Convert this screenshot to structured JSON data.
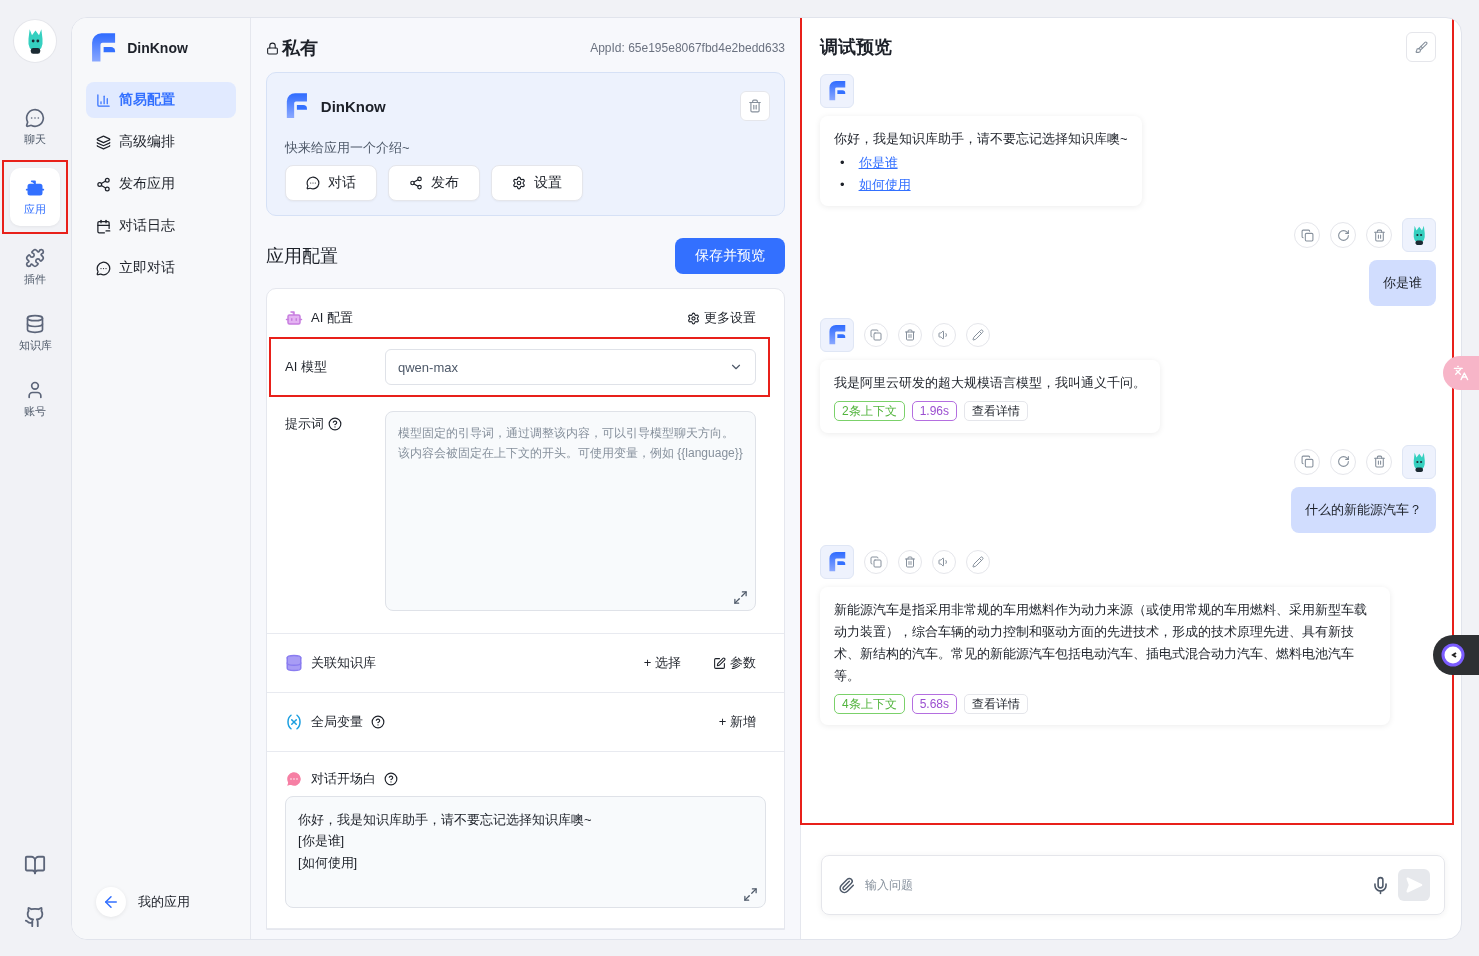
{
  "rail": {
    "items": [
      {
        "label": "聊天",
        "selected": false
      },
      {
        "label": "应用",
        "selected": true
      },
      {
        "label": "插件",
        "selected": false
      },
      {
        "label": "知识库",
        "selected": false
      },
      {
        "label": "账号",
        "selected": false
      }
    ]
  },
  "sidebar": {
    "app_name": "DinKnow",
    "items": [
      {
        "label": "简易配置",
        "selected": true
      },
      {
        "label": "高级编排",
        "selected": false
      },
      {
        "label": "发布应用",
        "selected": false
      },
      {
        "label": "对话日志",
        "selected": false
      },
      {
        "label": "立即对话",
        "selected": false
      }
    ],
    "back_label": "我的应用"
  },
  "header": {
    "visibility": "私有",
    "app_id": "AppId: 65e195e8067fbd4e2bedd633"
  },
  "app_card": {
    "name": "DinKnow",
    "intro": "快来给应用一个介绍~",
    "buttons": [
      "对话",
      "发布",
      "设置"
    ]
  },
  "config": {
    "title": "应用配置",
    "save_button": "保存并预览",
    "ai": {
      "title": "AI 配置",
      "more": "更多设置",
      "model_label": "AI 模型",
      "model_value": "qwen-max",
      "prompt_label": "提示词",
      "prompt_placeholder": "模型固定的引导词，通过调整该内容，可以引导模型聊天方向。该内容会被固定在上下文的开头。可使用变量，例如 {{language}}"
    },
    "knowledge": {
      "title": "关联知识库",
      "select": "+ 选择",
      "params": "参数"
    },
    "variables": {
      "title": "全局变量",
      "add": "+ 新增"
    },
    "opening": {
      "title": "对话开场白",
      "value": "你好，我是知识库助手，请不要忘记选择知识库噢~\n[你是谁]\n[如何使用]"
    }
  },
  "chat": {
    "title": "调试预览",
    "messages": [
      {
        "kind": "bot",
        "text": "你好，我是知识库助手，请不要忘记选择知识库噢~",
        "links": [
          {
            "bullet": "•",
            "text": "你是谁"
          },
          {
            "bullet": "•",
            "text": "如何使用"
          }
        ]
      },
      {
        "kind": "user",
        "text": "你是谁"
      },
      {
        "kind": "bot",
        "text": "我是阿里云研发的超大规模语言模型，我叫通义千问。",
        "context": "2条上下文",
        "time": "1.96s",
        "detail": "查看详情"
      },
      {
        "kind": "user",
        "text": "什么的新能源汽车？"
      },
      {
        "kind": "bot",
        "text": "新能源汽车是指采用非常规的车用燃料作为动力来源（或使用常规的车用燃料、采用新型车载动力装置），综合车辆的动力控制和驱动方面的先进技术，形成的技术原理先进、具有新技术、新结构的汽车。常见的新能源汽车包括电动汽车、插电式混合动力汽车、燃料电池汽车等。",
        "context": "4条上下文",
        "time": "5.68s",
        "detail": "查看详情"
      }
    ],
    "input": {
      "placeholder": "输入问题"
    }
  }
}
